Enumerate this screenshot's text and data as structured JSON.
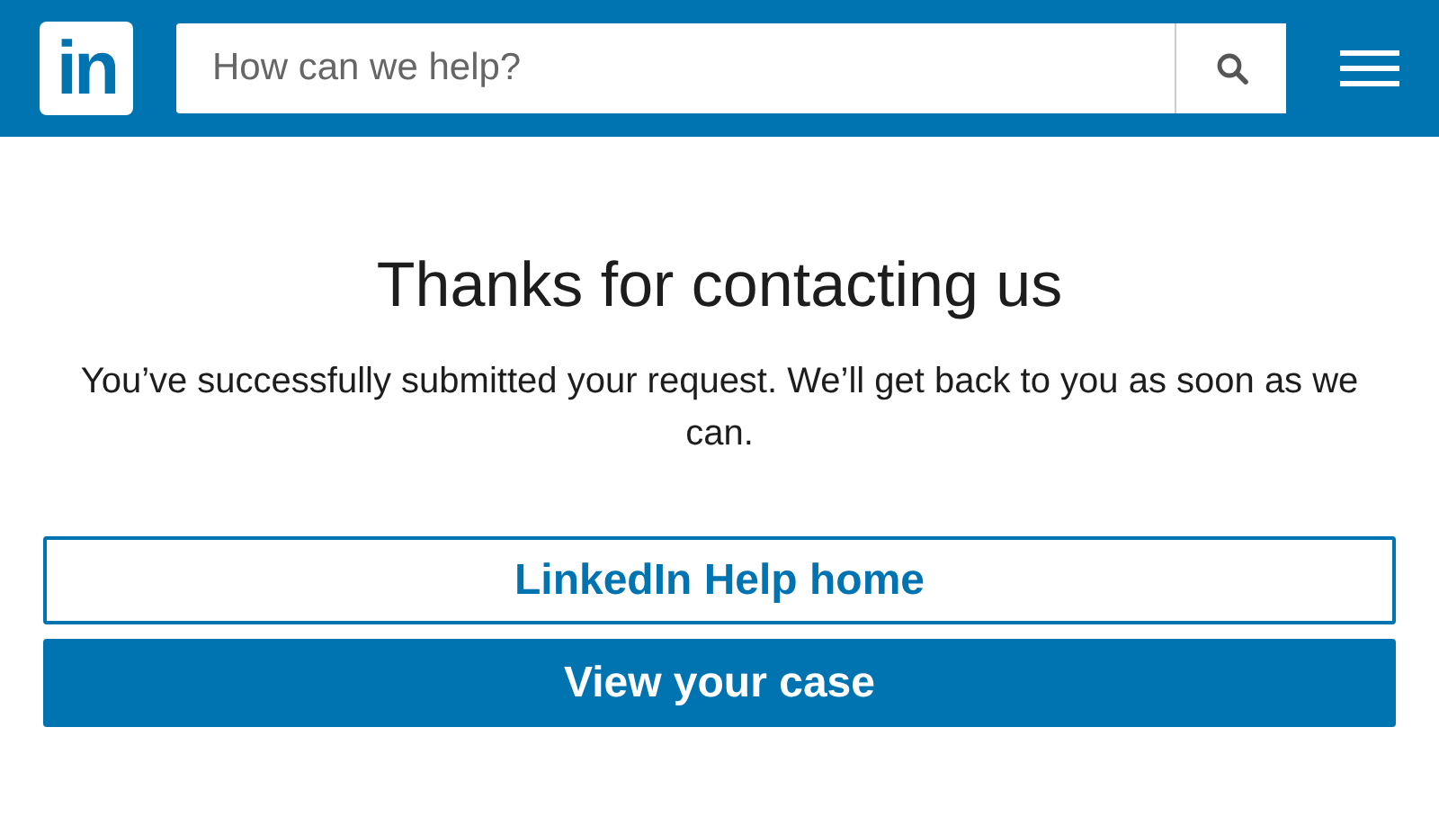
{
  "header": {
    "logo": "in",
    "search": {
      "placeholder": "How can we help?"
    }
  },
  "title": "Thanks for contacting us",
  "message": "You’ve successfully submitted your request. We’ll get back to you as soon as we can.",
  "buttons": [
    {
      "label": "LinkedIn Help home",
      "kind": "outline"
    },
    {
      "label": "View your case",
      "kind": "primary"
    }
  ]
}
